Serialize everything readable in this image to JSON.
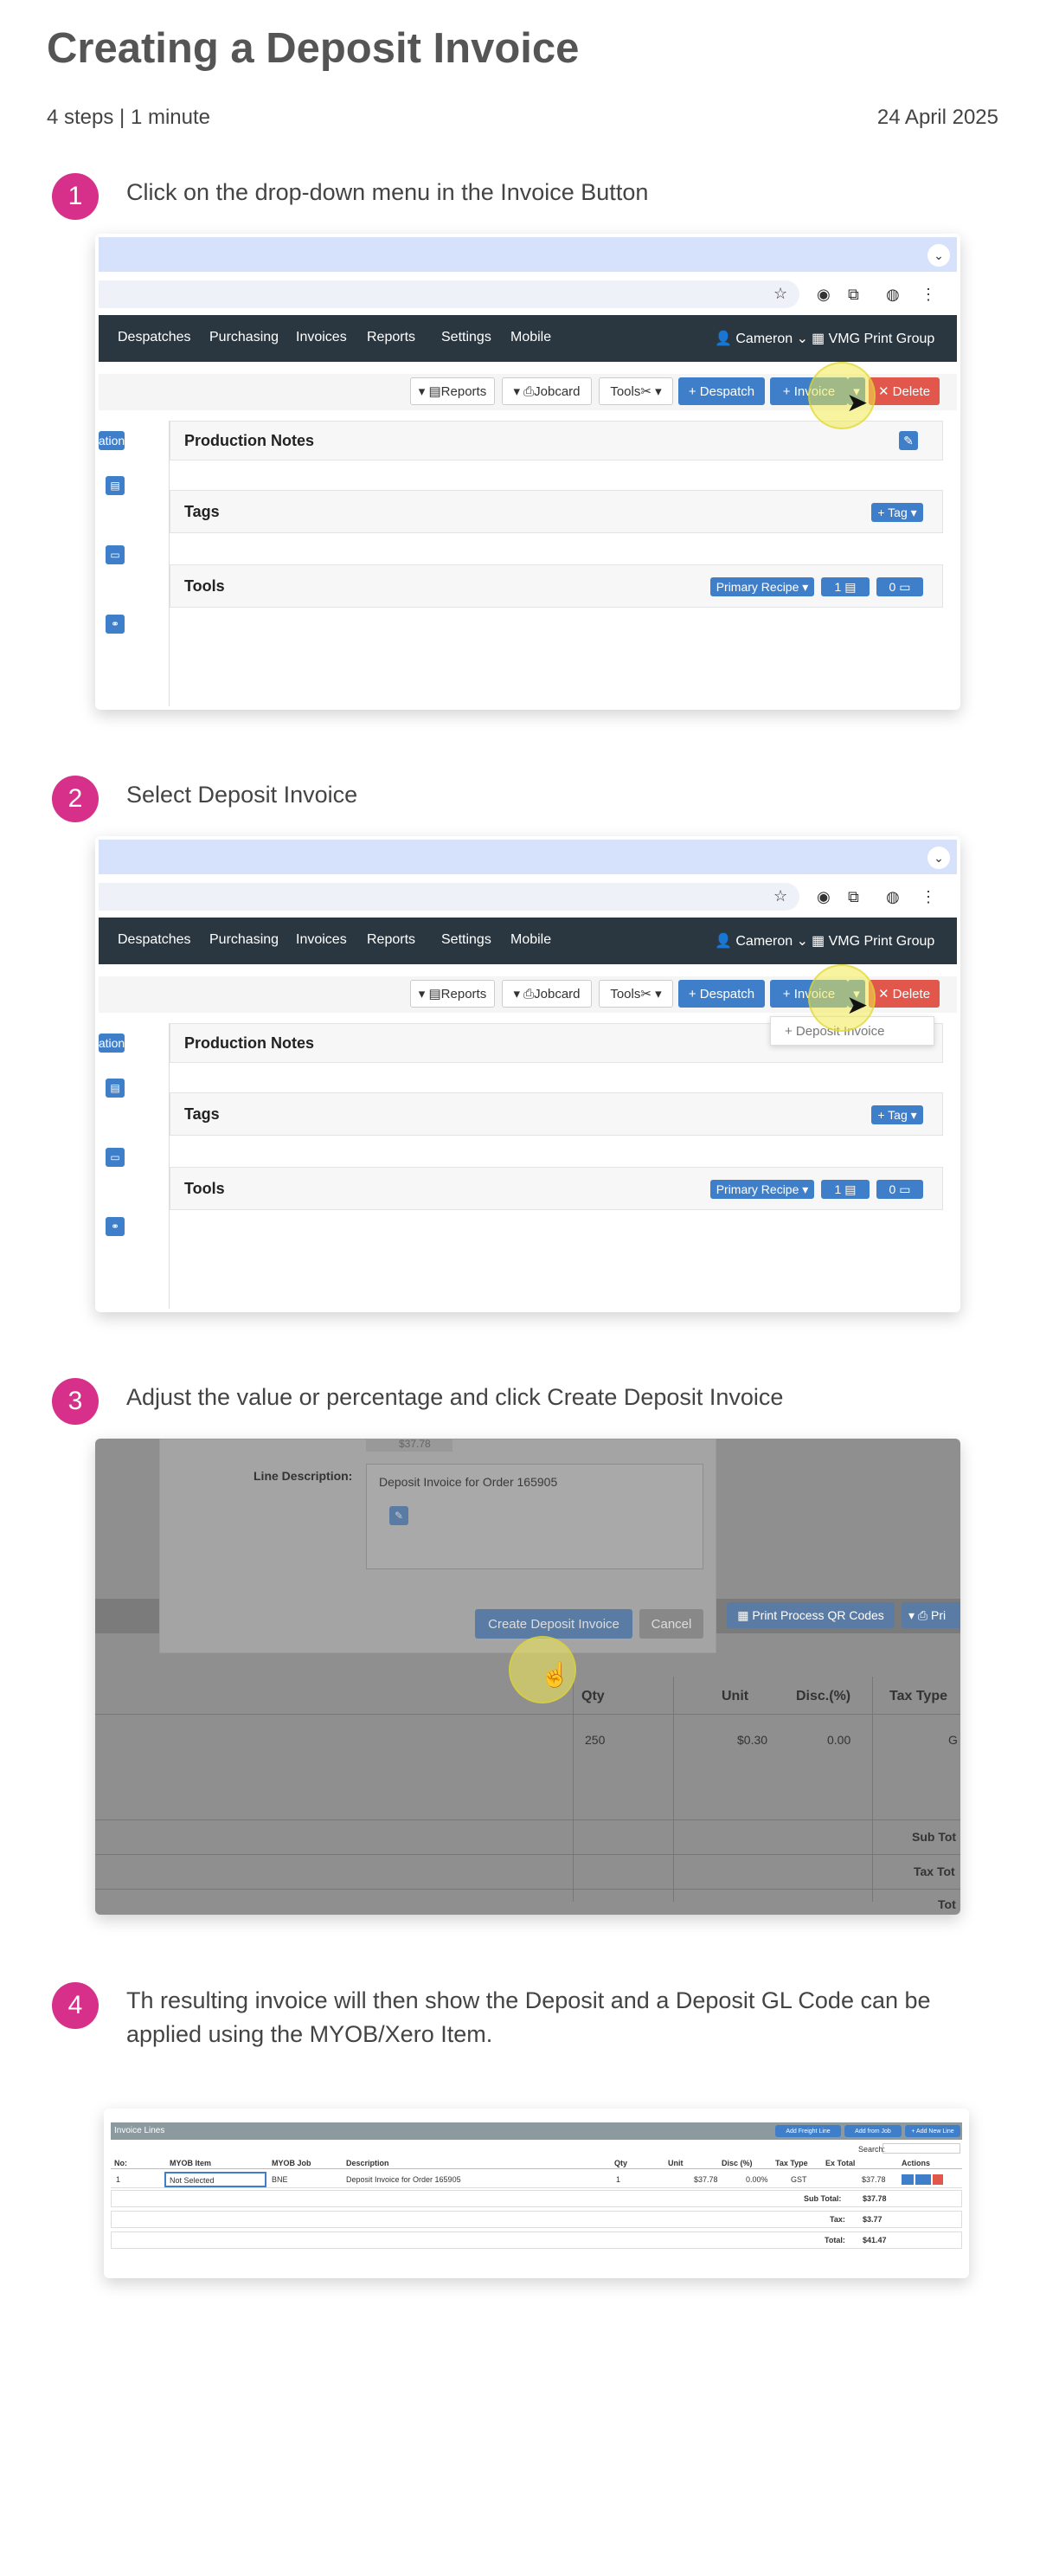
{
  "title": "Creating a Deposit Invoice",
  "meta": "4 steps | 1 minute",
  "date": "24 April 2025",
  "steps": [
    {
      "num": "1",
      "text": "Click on the drop-down menu in the Invoice Button"
    },
    {
      "num": "2",
      "text": "Select Deposit Invoice"
    },
    {
      "num": "3",
      "text": "Adjust the value or percentage and click Create Deposit Invoice"
    },
    {
      "num": "4",
      "text": "Th resulting invoice will then show the Deposit and a Deposit GL Code can be applied using the MYOB/Xero Item."
    }
  ],
  "nav": {
    "items": [
      "Despatches",
      "Purchasing",
      "Invoices",
      "Reports",
      "Settings",
      "Mobile"
    ],
    "user": "Cameron",
    "company": "VMG Print Group"
  },
  "toolbar": {
    "reports": "Reports",
    "jobcard": "Jobcard",
    "tools": "Tools",
    "despatch": "+ Despatch",
    "invoice": "+ Invoice",
    "delete": "✕ Delete"
  },
  "panels": {
    "production_notes": "Production Notes",
    "tags": "Tags",
    "tag_button": "+ Tag",
    "tools": "Tools",
    "primary_recipe": "Primary Recipe",
    "count1": "1",
    "count2": "0",
    "left_tab": "ation"
  },
  "dropdown": {
    "deposit_invoice": "+ Deposit Invoice"
  },
  "modal": {
    "line_description_label": "Line Description:",
    "line_description_value": "Deposit Invoice for Order 165905",
    "amount": "$37.78",
    "create": "Create Deposit Invoice",
    "cancel": "Cancel",
    "print_qr": "Print Process QR Codes",
    "print": "Pri"
  },
  "table3": {
    "headers": [
      "Qty",
      "Unit",
      "Disc.(%)",
      "Tax Type"
    ],
    "row": [
      "250",
      "$0.30",
      "0.00",
      "G"
    ],
    "sub_total": "Sub Tot",
    "tax_total": "Tax Tot",
    "total": "Tot"
  },
  "invoice_lines": {
    "title": "Invoice Lines",
    "buttons": [
      "Add Freight Line",
      "Add from Job",
      "+ Add New Line"
    ],
    "search": "Search:",
    "headers": [
      "No:",
      "MYOB Item",
      "MYOB Job",
      "Description",
      "Qty",
      "Unit",
      "Disc (%)",
      "Tax Type",
      "Ex Total",
      "Actions"
    ],
    "row": [
      "1",
      "Not Selected",
      "BNE",
      "Deposit Invoice for Order 165905",
      "1",
      "$37.78",
      "0.00%",
      "GST",
      "$37.78"
    ],
    "sub_total_label": "Sub Total:",
    "sub_total": "$37.78",
    "tax_label": "Tax:",
    "tax": "$3.77",
    "total_label": "Total:",
    "total": "$41.47"
  },
  "colors": {
    "accent": "#d6308a",
    "button_blue": "#3f7fca",
    "delete_red": "#e2574c",
    "navbar": "#2b3740"
  }
}
